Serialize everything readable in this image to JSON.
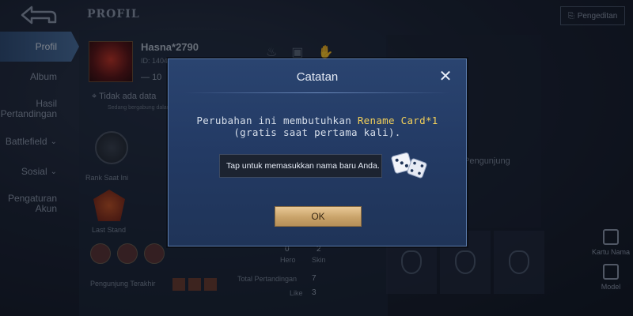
{
  "screen": {
    "title": "PROFIL"
  },
  "nav": {
    "items": [
      {
        "label": "Profil"
      },
      {
        "label": "Album"
      },
      {
        "label": "Hasil Pertandingan"
      },
      {
        "label": "Battlefield"
      },
      {
        "label": "Sosial"
      },
      {
        "label": "Pengaturan Akun"
      }
    ]
  },
  "profile": {
    "username": "Hasna*2790",
    "id_text": "ID: 1404",
    "level": "10",
    "location": "Tidak ada data",
    "location_note": "Sedang bergabung dalam",
    "rank_label": "Rank Saat Ini",
    "last_label": "Last Stand",
    "fav_label": "Pengunjung Terakhir",
    "stats": [
      {
        "label": "Total Pertandingan",
        "value": "7"
      },
      {
        "label": "Like",
        "value": "3"
      },
      {
        "label": "Hero",
        "value": "0"
      },
      {
        "label": "Skin",
        "value": "2"
      }
    ]
  },
  "right": {
    "visitor_text": "Pengunjung",
    "top_button": "Pengeditan",
    "side_buttons": [
      {
        "label": "Kartu Nama"
      },
      {
        "label": "Model"
      }
    ]
  },
  "dialog": {
    "title": "Catatan",
    "message_part1": "Perubahan ini membutuhkan ",
    "message_highlight": "Rename Card*1",
    "message_part2": "(gratis saat pertama kali).",
    "input_placeholder": "Tap untuk memasukkan nama baru Anda.",
    "ok_label": "OK"
  },
  "colors": {
    "highlight": "#f3d05a",
    "dialog_bg": "#233a64",
    "ok_button": "#c9a36a"
  }
}
